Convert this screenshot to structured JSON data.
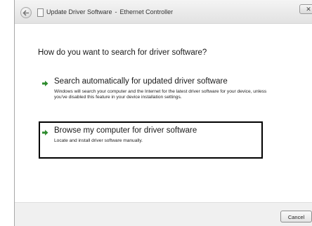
{
  "titlebar": {
    "app_title": "Update Driver Software",
    "separator": "-",
    "device_name": "Ethernet Controller",
    "close_glyph": "✕"
  },
  "content": {
    "question": "How do you want to search for driver software?",
    "options": [
      {
        "title": "Search automatically for updated driver software",
        "description": "Windows will search your computer and the Internet for the latest driver software for your device, unless you've disabled this feature in your device installation settings.",
        "icon": "green-arrow-icon"
      },
      {
        "title": "Browse my computer for driver software",
        "description": "Locate and install driver software manually.",
        "icon": "green-arrow-icon",
        "highlighted": true
      }
    ]
  },
  "footer": {
    "cancel_label": "Cancel"
  },
  "colors": {
    "arrow_green": "#2e8b2e",
    "highlight_border": "#000000"
  }
}
